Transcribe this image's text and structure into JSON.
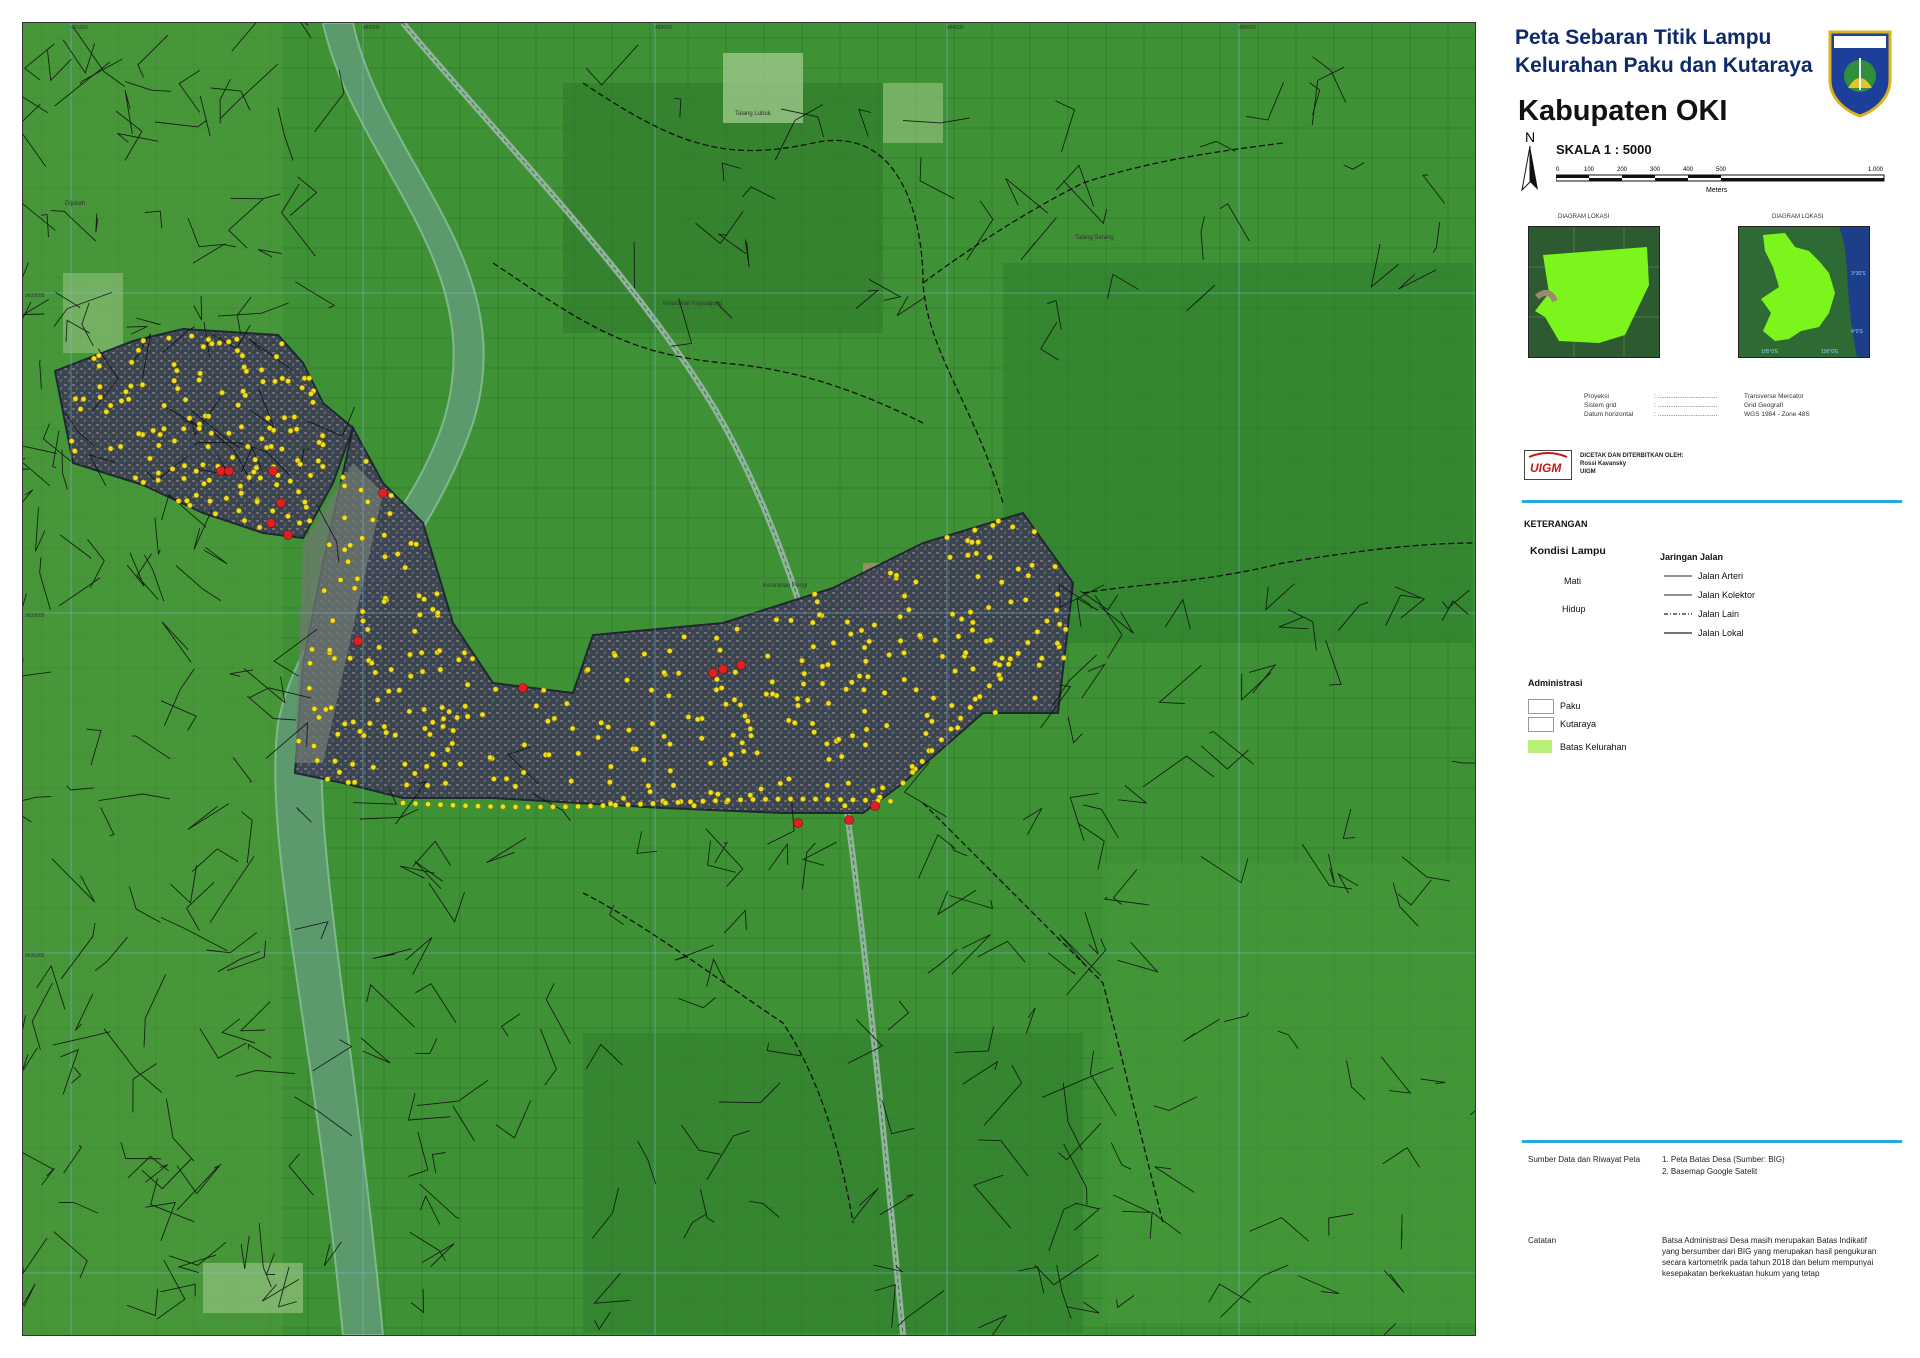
{
  "map": {
    "ticks_top": [
      "481000",
      "482000",
      "483000",
      "484000",
      "485000"
    ],
    "ticks_left": [
      "9633000",
      "9632000",
      "9631000"
    ],
    "place_labels": [
      "Dijokah",
      "Talang Lubuk",
      "Kelurahan Kayuagung",
      "Kelurahan Perigi",
      "Talang Serang"
    ]
  },
  "title": {
    "line1": "Peta Sebaran Titik Lampu",
    "line2": "Kelurahan Paku dan Kutaraya",
    "line3": "Kabupaten OKI",
    "emblem_text": "OGAN KOMERING ILIR"
  },
  "north_label": "N",
  "scale": {
    "label": "SKALA 1 : 5000",
    "ticks": [
      "0",
      "100",
      "200",
      "300",
      "400",
      "500",
      "1.000"
    ],
    "unit": "Meters"
  },
  "insets": {
    "caption_left": "DIAGRAM LOKASI",
    "caption_right": "DIAGRAM LOKASI",
    "right_lat_labels": [
      "3°30'S",
      "4°0'S"
    ],
    "right_lon_labels": [
      "105°0'E",
      "106°0'E"
    ]
  },
  "projection": {
    "rows": [
      {
        "key": "Proyeksi",
        "val": "Transverse Mercator"
      },
      {
        "key": "Sistem grid",
        "val": "Grid Geografi"
      },
      {
        "key": "Datum horizontal",
        "val": "WGS 1984 - Zone 48S"
      }
    ]
  },
  "publisher": {
    "logo_text": "UIGM",
    "line1": "DICETAK DAN DITERBITKAN OLEH:",
    "line2": "Rossi Kavansky",
    "line3": "UIGM"
  },
  "legend": {
    "title": "KETERANGAN",
    "kondisi_title": "Kondisi Lampu",
    "mati": "Mati",
    "hidup": "Hidup",
    "jaringan_title": "Jaringan Jalan",
    "roads": [
      "Jalan Arteri",
      "Jalan Kolektor",
      "Jalan Lain",
      "Jalan Lokal"
    ],
    "admin_title": "Administrasi",
    "admin_items": [
      "Paku",
      "Kutaraya",
      "Batas Kelurahan"
    ],
    "colors": {
      "mati": "#e02020",
      "hidup": "#f2e01a",
      "batas": "#b9f07a"
    }
  },
  "sources": {
    "label": "Sumber Data dan Riwayat Peta",
    "items": [
      "1. Peta Batas Desa (Sumber: BIG)",
      "2. Basemap Google Satelit"
    ]
  },
  "notes": {
    "label": "Catatan",
    "lines": [
      "Batsa Administrasi Desa masih merupakan Batas Indikatif",
      "yang bersumber dari BIG yang merupakan hasil pengukuran",
      "secara kartometrik pada tahun 2018 dan belum mempunyai",
      "kesepakatan berkekuatan hukum yang tetap"
    ]
  }
}
